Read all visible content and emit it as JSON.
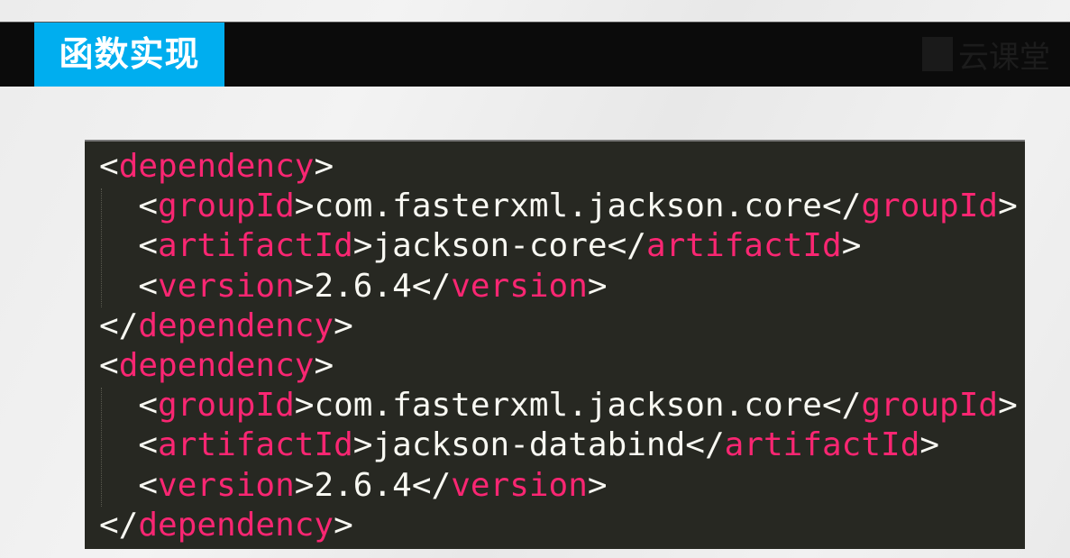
{
  "header": {
    "title": "函数实现",
    "logo_text": "云课堂"
  },
  "code": {
    "lines": [
      {
        "indent": "",
        "open": "<",
        "tag": "dependency",
        "close": ">",
        "text": "",
        "end_open": "",
        "end_tag": "",
        "end_close": ""
      },
      {
        "indent": "  ",
        "open": "<",
        "tag": "groupId",
        "close": ">",
        "text": "com.fasterxml.jackson.core",
        "end_open": "</",
        "end_tag": "groupId",
        "end_close": ">"
      },
      {
        "indent": "  ",
        "open": "<",
        "tag": "artifactId",
        "close": ">",
        "text": "jackson-core",
        "end_open": "</",
        "end_tag": "artifactId",
        "end_close": ">"
      },
      {
        "indent": "  ",
        "open": "<",
        "tag": "version",
        "close": ">",
        "text": "2.6.4",
        "end_open": "</",
        "end_tag": "version",
        "end_close": ">"
      },
      {
        "indent": "",
        "open": "</",
        "tag": "dependency",
        "close": ">",
        "text": "",
        "end_open": "",
        "end_tag": "",
        "end_close": ""
      },
      {
        "indent": "",
        "open": "<",
        "tag": "dependency",
        "close": ">",
        "text": "",
        "end_open": "",
        "end_tag": "",
        "end_close": ""
      },
      {
        "indent": "  ",
        "open": "<",
        "tag": "groupId",
        "close": ">",
        "text": "com.fasterxml.jackson.core",
        "end_open": "</",
        "end_tag": "groupId",
        "end_close": ">"
      },
      {
        "indent": "  ",
        "open": "<",
        "tag": "artifactId",
        "close": ">",
        "text": "jackson-databind",
        "end_open": "</",
        "end_tag": "artifactId",
        "end_close": ">"
      },
      {
        "indent": "  ",
        "open": "<",
        "tag": "version",
        "close": ">",
        "text": "2.6.4",
        "end_open": "</",
        "end_tag": "version",
        "end_close": ">"
      },
      {
        "indent": "",
        "open": "</",
        "tag": "dependency",
        "close": ">",
        "text": "",
        "end_open": "",
        "end_tag": "",
        "end_close": ""
      }
    ]
  },
  "colors": {
    "accent": "#00aeef",
    "tag": "#f92672",
    "code_bg": "#272822",
    "code_text": "#f8f8f2"
  }
}
